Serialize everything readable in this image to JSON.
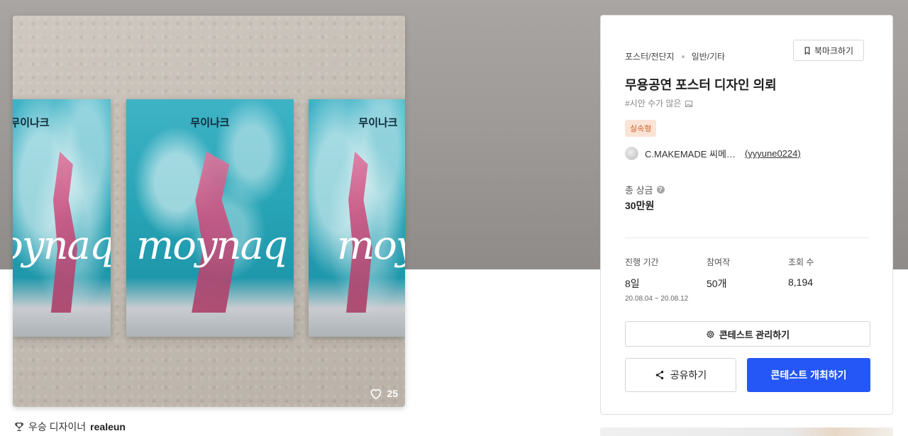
{
  "artwork": {
    "poster_title": "무이나크",
    "poster_script": "moynaq",
    "likes": "25"
  },
  "designer": {
    "label": "우승 디자이너",
    "name": "realeun"
  },
  "contest": {
    "category_main": "포스터/전단지",
    "category_sub": "일반/기타",
    "bookmark_label": "북마크하기",
    "title": "무용공연 포스터 디자인 의뢰",
    "tag": "#시안 수가 많은",
    "badge": "실속형",
    "host_name": "C.MAKEMADE 씨메…",
    "host_id": "(yyyune0224)",
    "prize_label": "총 상금",
    "prize_value": "30만원",
    "stats": {
      "period_label": "진행 기간",
      "period_value": "8일",
      "period_dates": "20.08.04 ~ 20.08.12",
      "entries_label": "참여작",
      "entries_value": "50개",
      "views_label": "조회 수",
      "views_value": "8,194"
    },
    "manage_label": "콘테스트 관리하기",
    "share_label": "공유하기",
    "open_label": "콘테스트 개최하기"
  },
  "colors": {
    "primary": "#2457f5",
    "badge_bg": "#fbe4d6",
    "badge_text": "#d0632b"
  }
}
